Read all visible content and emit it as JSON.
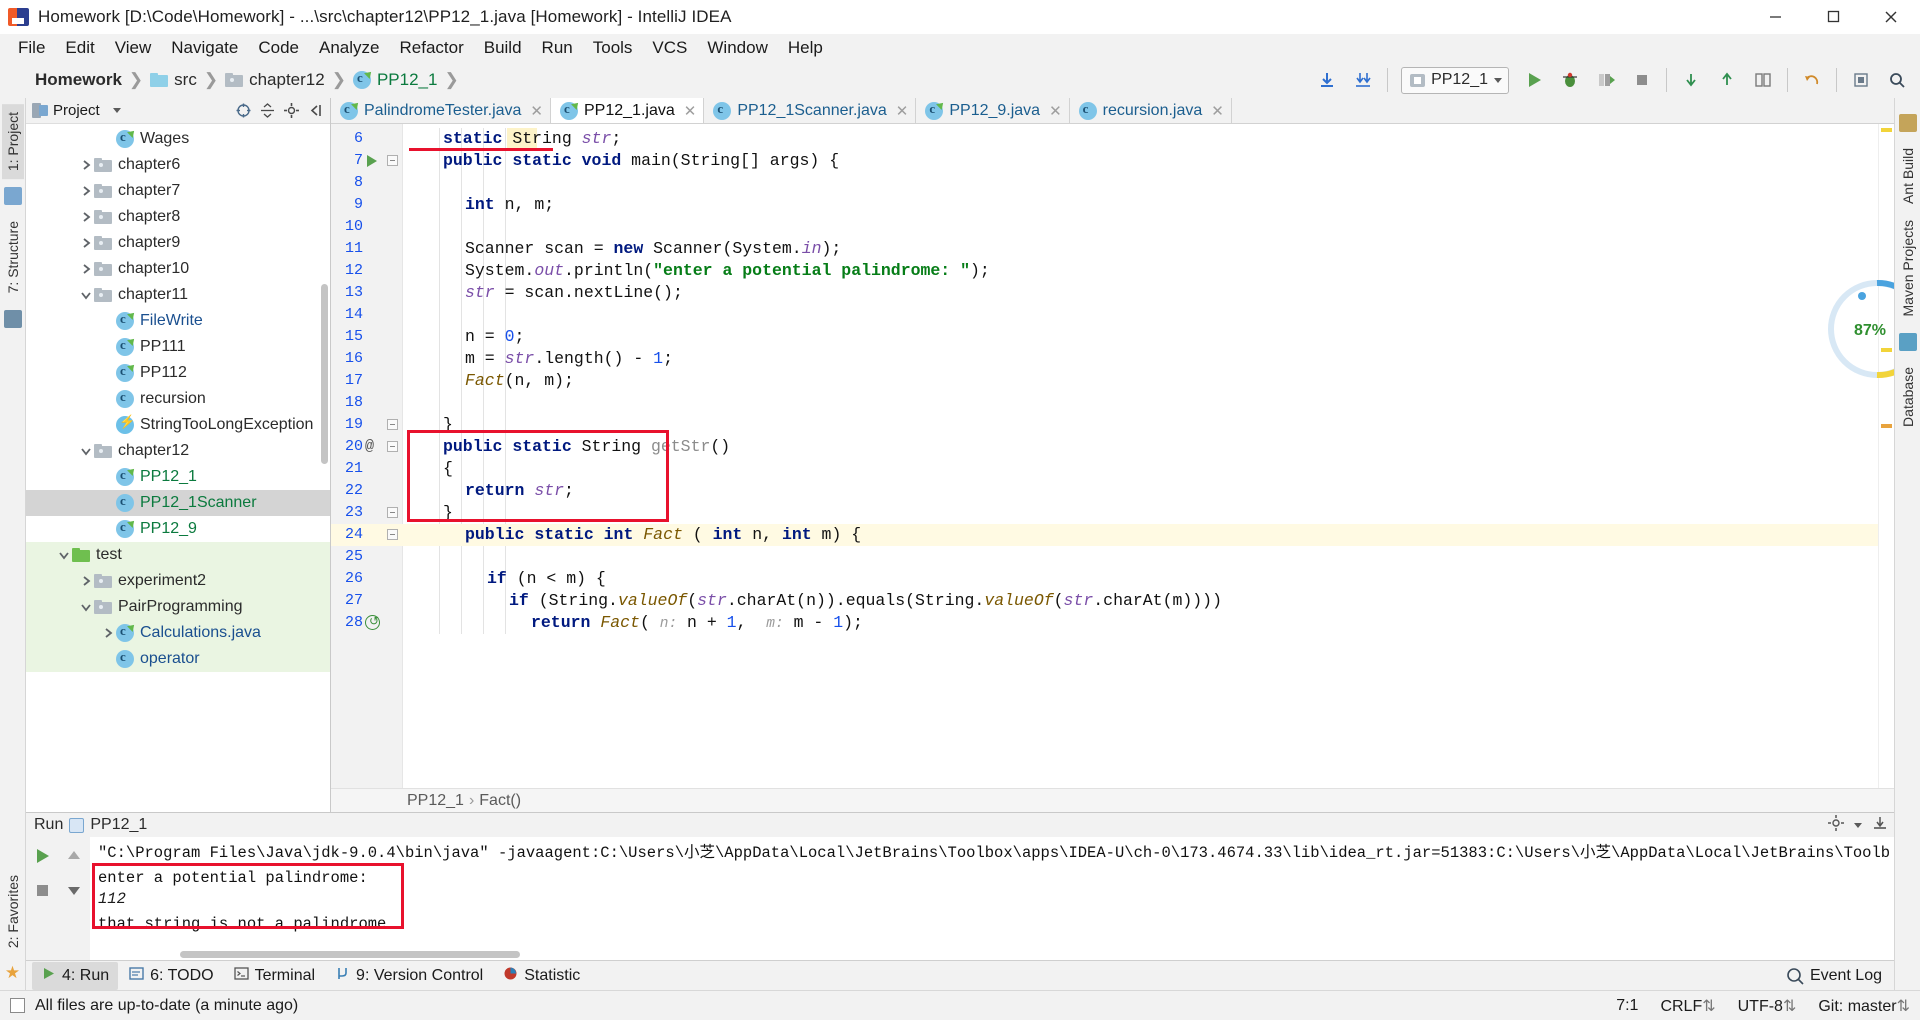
{
  "window": {
    "title": "Homework [D:\\Code\\Homework] - ...\\src\\chapter12\\PP12_1.java [Homework] - IntelliJ IDEA",
    "minimize_label": "minimize-icon",
    "maximize_label": "maximize-icon",
    "close_label": "close-icon"
  },
  "menu": [
    {
      "label": "File"
    },
    {
      "label": "Edit"
    },
    {
      "label": "View"
    },
    {
      "label": "Navigate"
    },
    {
      "label": "Code"
    },
    {
      "label": "Analyze"
    },
    {
      "label": "Refactor"
    },
    {
      "label": "Build"
    },
    {
      "label": "Run"
    },
    {
      "label": "Tools"
    },
    {
      "label": "VCS"
    },
    {
      "label": "Window"
    },
    {
      "label": "Help"
    }
  ],
  "navbar": {
    "breadcrumbs": [
      "Homework",
      "src",
      "chapter12",
      "PP12_1"
    ],
    "run_config": "PP12_1",
    "icons": [
      "download-icon",
      "download-all-icon",
      "run-icon",
      "debug-icon",
      "coverage-icon",
      "stop-icon",
      "vcs-update-icon",
      "vcs-commit-icon",
      "vcs-diff-icon",
      "undo-icon",
      "settings-icon",
      "search-icon"
    ]
  },
  "left_strip": {
    "tabs": [
      "1: Project",
      "7: Structure"
    ],
    "bottom_tabs": [
      "2: Favorites"
    ]
  },
  "right_strip": {
    "tabs": [
      "Ant Build",
      "Maven Projects",
      "Database"
    ]
  },
  "project_panel": {
    "title": "Project",
    "actions": [
      "locate-icon",
      "collapse-all-icon",
      "settings-icon",
      "hide-icon"
    ],
    "tree": [
      {
        "label": "Wages",
        "indent": 3,
        "icon": "java-class-run-icon",
        "arrow": "none",
        "color": "default"
      },
      {
        "label": "chapter6",
        "indent": 2,
        "icon": "folder-icon",
        "arrow": "right",
        "color": "default"
      },
      {
        "label": "chapter7",
        "indent": 2,
        "icon": "folder-icon",
        "arrow": "right",
        "color": "default"
      },
      {
        "label": "chapter8",
        "indent": 2,
        "icon": "folder-icon",
        "arrow": "right",
        "color": "default"
      },
      {
        "label": "chapter9",
        "indent": 2,
        "icon": "folder-icon",
        "arrow": "right",
        "color": "default"
      },
      {
        "label": "chapter10",
        "indent": 2,
        "icon": "folder-icon",
        "arrow": "right",
        "color": "default"
      },
      {
        "label": "chapter11",
        "indent": 2,
        "icon": "folder-icon",
        "arrow": "down",
        "color": "default"
      },
      {
        "label": "FileWrite",
        "indent": 3,
        "icon": "java-class-run-icon",
        "arrow": "none",
        "color": "blue"
      },
      {
        "label": "PP111",
        "indent": 3,
        "icon": "java-class-run-icon",
        "arrow": "none",
        "color": "default"
      },
      {
        "label": "PP112",
        "indent": 3,
        "icon": "java-class-run-icon",
        "arrow": "none",
        "color": "default"
      },
      {
        "label": "recursion",
        "indent": 3,
        "icon": "java-class-icon",
        "arrow": "none",
        "color": "default"
      },
      {
        "label": "StringTooLongException",
        "indent": 3,
        "icon": "exception-class-icon",
        "arrow": "none",
        "color": "default"
      },
      {
        "label": "chapter12",
        "indent": 2,
        "icon": "folder-icon",
        "arrow": "down",
        "color": "default"
      },
      {
        "label": "PP12_1",
        "indent": 3,
        "icon": "java-class-run-icon",
        "arrow": "none",
        "color": "green"
      },
      {
        "label": "PP12_1Scanner",
        "indent": 3,
        "icon": "java-class-icon",
        "arrow": "none",
        "color": "green",
        "selected": true
      },
      {
        "label": "PP12_9",
        "indent": 3,
        "icon": "java-class-run-icon",
        "arrow": "none",
        "color": "green"
      },
      {
        "label": "test",
        "indent": 1,
        "icon": "test-folder-icon",
        "arrow": "down",
        "color": "default",
        "highlight": "green"
      },
      {
        "label": "experiment2",
        "indent": 2,
        "icon": "folder-icon",
        "arrow": "right",
        "color": "default",
        "highlight": "green"
      },
      {
        "label": "PairProgramming",
        "indent": 2,
        "icon": "folder-icon",
        "arrow": "down",
        "color": "default",
        "highlight": "green"
      },
      {
        "label": "Calculations.java",
        "indent": 3,
        "icon": "java-class-run-icon",
        "arrow": "right",
        "color": "blue",
        "highlight": "green"
      },
      {
        "label": "operator",
        "indent": 3,
        "icon": "java-class-icon",
        "arrow": "none",
        "color": "blue",
        "highlight": "green"
      }
    ]
  },
  "editor": {
    "tabs": [
      {
        "label": "PalindromeTester.java",
        "active": false
      },
      {
        "label": "PP12_1.java",
        "active": true
      },
      {
        "label": "PP12_1Scanner.java",
        "active": false
      },
      {
        "label": "PP12_9.java",
        "active": false
      },
      {
        "label": "recursion.java",
        "active": false
      }
    ],
    "first_line_number": 6,
    "lines": [
      {
        "n": 6,
        "indent": 1,
        "text": "static String str;"
      },
      {
        "n": 7,
        "indent": 1,
        "text": "public static void main(String[] args) {"
      },
      {
        "n": 8,
        "indent": 0,
        "text": ""
      },
      {
        "n": 9,
        "indent": 2,
        "text": "int n, m;"
      },
      {
        "n": 10,
        "indent": 0,
        "text": ""
      },
      {
        "n": 11,
        "indent": 2,
        "text": "Scanner scan = new Scanner(System.in);"
      },
      {
        "n": 12,
        "indent": 2,
        "text": "System.out.println(\"enter a potential palindrome: \");"
      },
      {
        "n": 13,
        "indent": 2,
        "text": "str = scan.nextLine();"
      },
      {
        "n": 14,
        "indent": 0,
        "text": ""
      },
      {
        "n": 15,
        "indent": 2,
        "text": "n = 0;"
      },
      {
        "n": 16,
        "indent": 2,
        "text": "m = str.length() - 1;"
      },
      {
        "n": 17,
        "indent": 2,
        "text": "Fact(n, m);"
      },
      {
        "n": 18,
        "indent": 0,
        "text": ""
      },
      {
        "n": 19,
        "indent": 1,
        "text": "}"
      },
      {
        "n": 20,
        "indent": 1,
        "text": "public static String getStr()"
      },
      {
        "n": 21,
        "indent": 1,
        "text": "{"
      },
      {
        "n": 22,
        "indent": 2,
        "text": "return str;"
      },
      {
        "n": 23,
        "indent": 1,
        "text": "}"
      },
      {
        "n": 24,
        "indent": 2,
        "text": "public static int Fact ( int n, int m) {"
      },
      {
        "n": 25,
        "indent": 0,
        "text": ""
      },
      {
        "n": 26,
        "indent": 3,
        "text": "if (n < m) {"
      },
      {
        "n": 27,
        "indent": 4,
        "text": "if (String.valueOf(str.charAt(n)).equals(String.valueOf(str.charAt(m))))"
      },
      {
        "n": 28,
        "indent": 5,
        "text": "return Fact( n: n + 1,  m: m - 1);"
      }
    ],
    "breadcrumb": [
      "PP12_1",
      "Fact()"
    ],
    "inspection_percent": "87%"
  },
  "run_panel": {
    "title": "Run",
    "config_name": "PP12_1",
    "console_lines": [
      "\"C:\\Program Files\\Java\\jdk-9.0.4\\bin\\java\" -javaagent:C:\\Users\\小芝\\AppData\\Local\\JetBrains\\Toolbox\\apps\\IDEA-U\\ch-0\\173.4674.33\\lib\\idea_rt.jar=51383:C:\\Users\\小芝\\AppData\\Local\\JetBrains\\Toolb",
      "enter a potential palindrome:",
      "112",
      "that string is not a palindrome"
    ],
    "toolbar_icons": [
      "rerun-icon",
      "stop-icon",
      "scroll-up-icon",
      "scroll-down-icon",
      "settings-icon",
      "export-icon"
    ]
  },
  "bottom_tabs": [
    {
      "label": "4: Run",
      "icon": "run-icon",
      "selected": true
    },
    {
      "label": "6: TODO",
      "icon": "todo-icon",
      "selected": false
    },
    {
      "label": "Terminal",
      "icon": "terminal-icon",
      "selected": false
    },
    {
      "label": "9: Version Control",
      "icon": "vcs-icon",
      "selected": false
    },
    {
      "label": "Statistic",
      "icon": "stats-icon",
      "selected": false
    }
  ],
  "event_log": "Event Log",
  "status_bar": {
    "message": "All files are up-to-date (a minute ago)",
    "caret": "7:1",
    "line_sep": "CRLF",
    "encoding": "UTF-8",
    "branch": "Git: master"
  },
  "colors": {
    "accent_red": "#e8112d",
    "keyword_blue": "#00197f",
    "string_green": "#067d17",
    "tab_blue": "#1b5e8f",
    "tree_green": "#0b7a3e"
  }
}
